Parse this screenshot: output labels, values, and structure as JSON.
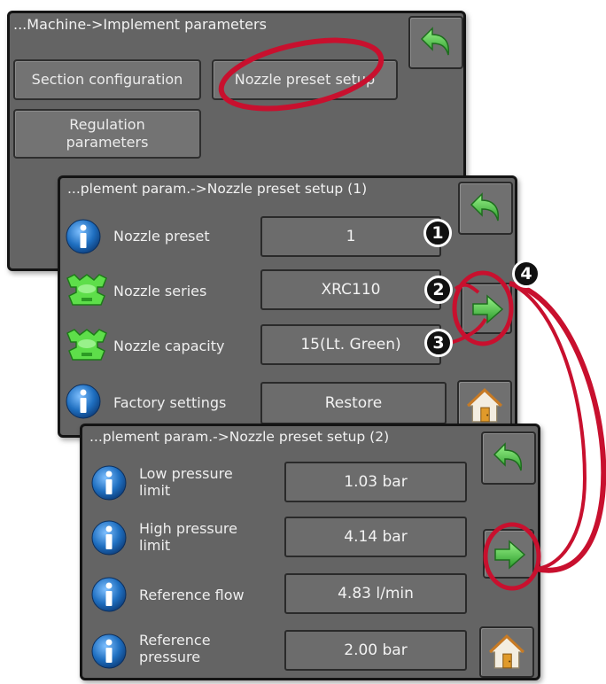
{
  "accent_colors": {
    "panel": "#646464",
    "info_icon": "#1f6fc0",
    "nozzle_icon": "#59d94a",
    "arrow": "#3fbf3f",
    "callout": "#c8102e"
  },
  "panel1": {
    "title": "...Machine->Implement parameters",
    "btn_section": "Section configuration",
    "btn_nozzle": "Nozzle preset setup",
    "btn_regulation": "Regulation\nparameters",
    "back_icon": "back-arrow-icon"
  },
  "panel2": {
    "title": "...plement param.->Nozzle preset setup (1)",
    "rows": [
      {
        "label": "Nozzle preset",
        "value": "1",
        "icon": "info-icon"
      },
      {
        "label": "Nozzle series",
        "value": "XRC110",
        "icon": "nozzle-icon"
      },
      {
        "label": "Nozzle capacity",
        "value": "15(Lt. Green)",
        "icon": "nozzle-icon"
      },
      {
        "label": "Factory settings",
        "value": "Restore",
        "icon": "info-icon"
      }
    ]
  },
  "panel3": {
    "title": "...plement param.->Nozzle preset setup (2)",
    "rows": [
      {
        "label": "Low pressure\nlimit",
        "value": "1.03 bar",
        "icon": "info-icon"
      },
      {
        "label": "High pressure\nlimit",
        "value": "4.14 bar",
        "icon": "info-icon"
      },
      {
        "label": "Reference flow",
        "value": "4.83 l/min",
        "icon": "info-icon"
      },
      {
        "label": "Reference\npressure",
        "value": "2.00 bar",
        "icon": "info-icon"
      }
    ]
  },
  "callouts": [
    "1",
    "2",
    "3",
    "4"
  ]
}
